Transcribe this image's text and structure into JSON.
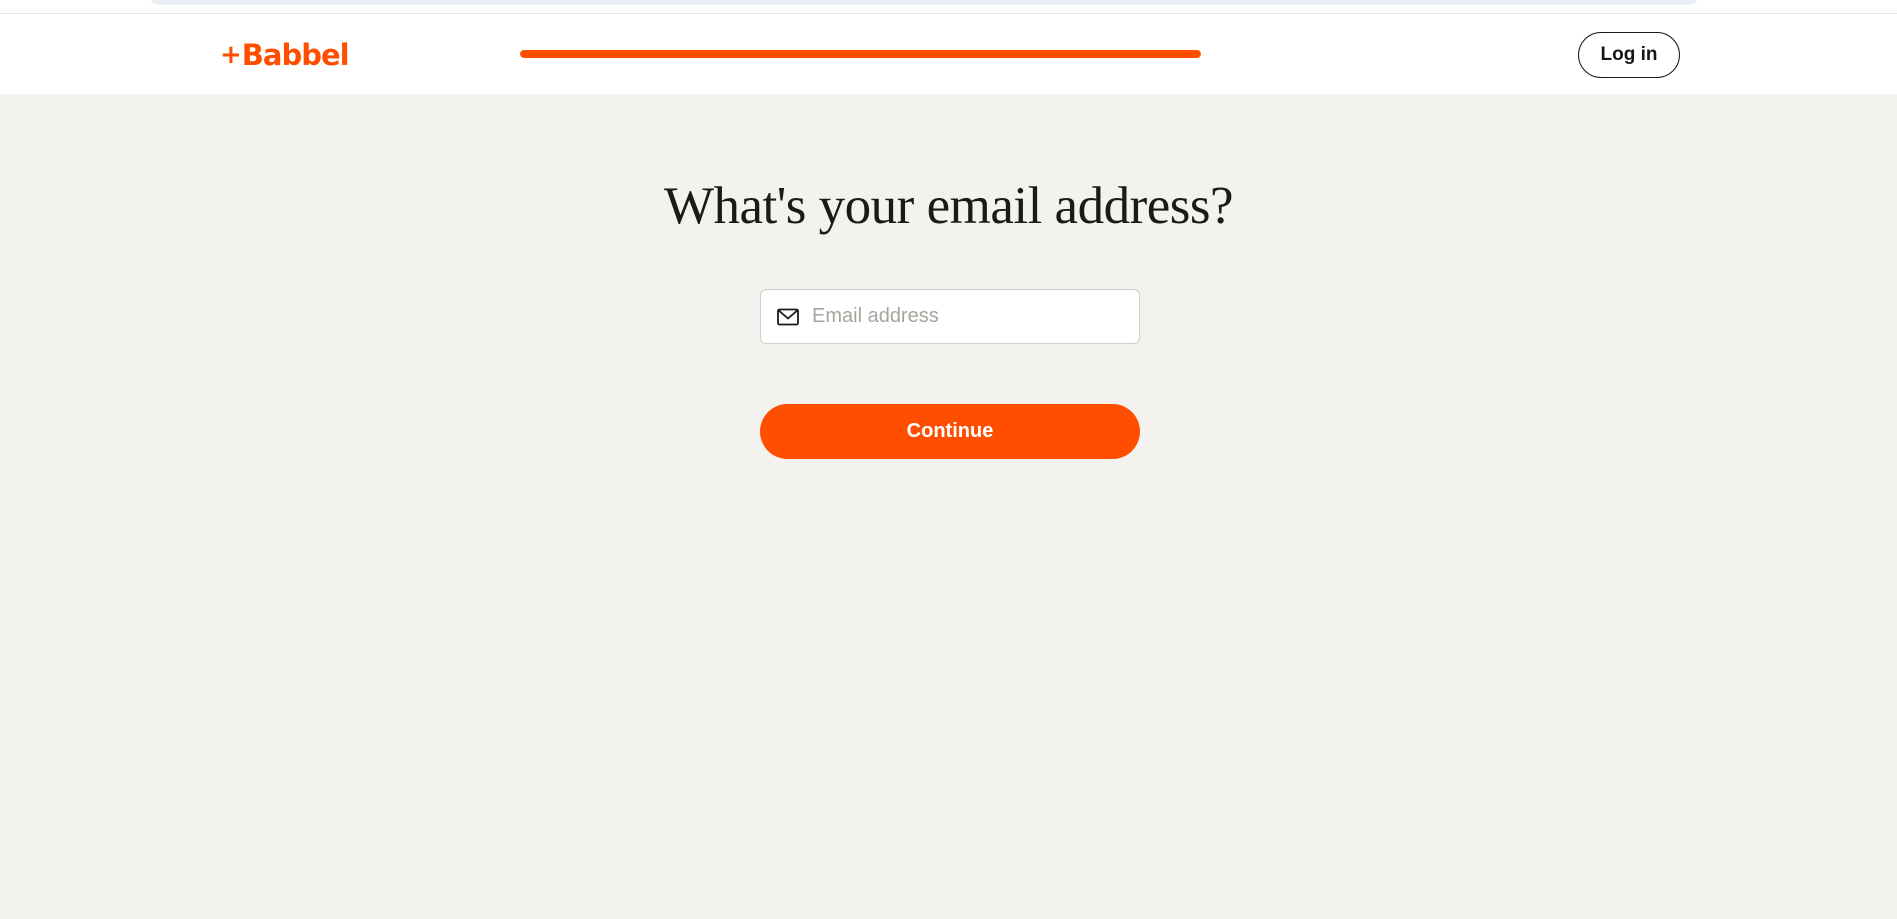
{
  "colors": {
    "brand": "#ff4e00",
    "background": "#f4f2ee",
    "header_background": "#ffffff",
    "text": "#1c1a17"
  },
  "header": {
    "logo_text": "Babbel",
    "logo_prefix": "+",
    "progress_fraction": 1.0,
    "login_label": "Log in"
  },
  "main": {
    "heading": "What's your email address?",
    "email_field": {
      "placeholder": "Email address",
      "value": "",
      "icon": "mail-icon"
    },
    "continue_label": "Continue"
  }
}
